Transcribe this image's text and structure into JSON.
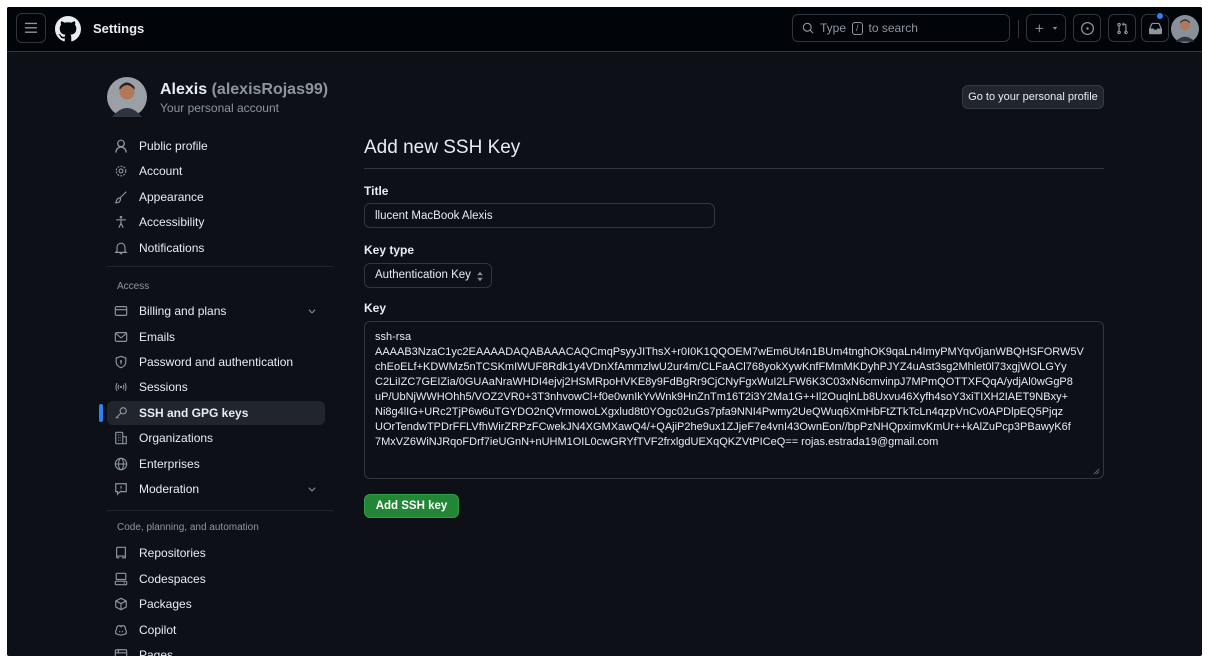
{
  "header": {
    "breadcrumb": "Settings",
    "search_prefix": "Type",
    "search_key": "/",
    "search_suffix": "to search"
  },
  "profile": {
    "name": "Alexis",
    "login": "(alexisRojas99)",
    "subtitle": "Your personal account",
    "profile_button": "Go to your personal profile"
  },
  "sidebar": {
    "top_items": [
      {
        "label": "Public profile",
        "icon": "person-icon"
      },
      {
        "label": "Account",
        "icon": "gear-icon"
      },
      {
        "label": "Appearance",
        "icon": "paintbrush-icon"
      },
      {
        "label": "Accessibility",
        "icon": "accessibility-icon"
      },
      {
        "label": "Notifications",
        "icon": "bell-icon"
      }
    ],
    "access_heading": "Access",
    "access_items": [
      {
        "label": "Billing and plans",
        "icon": "credit-card-icon",
        "expandable": true
      },
      {
        "label": "Emails",
        "icon": "mail-icon"
      },
      {
        "label": "Password and authentication",
        "icon": "shield-lock-icon"
      },
      {
        "label": "Sessions",
        "icon": "broadcast-icon"
      },
      {
        "label": "SSH and GPG keys",
        "icon": "key-icon",
        "active": true
      },
      {
        "label": "Organizations",
        "icon": "organization-icon"
      },
      {
        "label": "Enterprises",
        "icon": "globe-icon"
      },
      {
        "label": "Moderation",
        "icon": "report-icon",
        "expandable": true
      }
    ],
    "code_heading": "Code, planning, and automation",
    "code_items": [
      {
        "label": "Repositories",
        "icon": "repo-icon"
      },
      {
        "label": "Codespaces",
        "icon": "codespaces-icon"
      },
      {
        "label": "Packages",
        "icon": "package-icon"
      },
      {
        "label": "Copilot",
        "icon": "copilot-icon"
      },
      {
        "label": "Pages",
        "icon": "browser-icon"
      }
    ]
  },
  "main": {
    "title": "Add new SSH Key",
    "title_field_label": "Title",
    "title_field_value": "llucent MacBook Alexis",
    "key_type_label": "Key type",
    "key_type_value": "Authentication Key",
    "key_label": "Key",
    "key_lines": [
      "ssh-rsa",
      "AAAAB3NzaC1yc2EAAAADAQABAAACAQCmqPsyyJIThsX+r0I0K1QQOEM7wEm6Ut4n1BUm4tnghOK9qaLn4ImyPMYqv0janWBQHSFORW5V",
      "chEoELf+KDWMz5nTCSKmIWUF8Rdk1y4VDnXfAmmzlwU2ur4m/CLFaACl768yokXywKnfFMmMKDyhPJYZ4uAst3sg2Mhlet0l73xgjWOLGYy",
      "C2LiIZC7GEIZia/0GUAaNraWHDI4ejvj2HSMRpoHVKE8y9FdBgRr9CjCNyFgxWuI2LFW6K3C03xN6cmvinpJ7MPmQOTTXFQqA/ydjAl0wGgP8",
      "uP/UbNjWWHOhh5/VOZ2VR0+3T3nhvowCl+f0e0wnIkYvWnk9HnZnTm16T2i3Y2Ma1G++Il2OuqlnLb8Uxvu46Xyfh4soY3xiTIXH2IAET9NBxy+",
      "Ni8g4lIG+URc2TjP6w6uTGYDO2nQVrmowoLXgxlud8t0YOgc02uGs7pfa9NNI4Pwmy2UeQWuq6XmHbFtZTkTcLn4qzpVnCv0APDlpEQ5Pjqz",
      "UOrTendwTPDrFFLVfhWirZRPzFCwekJN4XGMXawQ4/+QAjiP2he9ux1ZJjeF7e4vnI43OwnEon//bpPzNHQpximvKmUr++kAlZuPcp3PBawyK6f",
      "7MxVZ6WiNJRqoFDrf7ieUGnN+nUHM1OIL0cwGRYfTVF2frxlgdUEXqQKZVtPICeQ== rojas.estrada19@gmail.com"
    ],
    "submit_label": "Add SSH key"
  }
}
